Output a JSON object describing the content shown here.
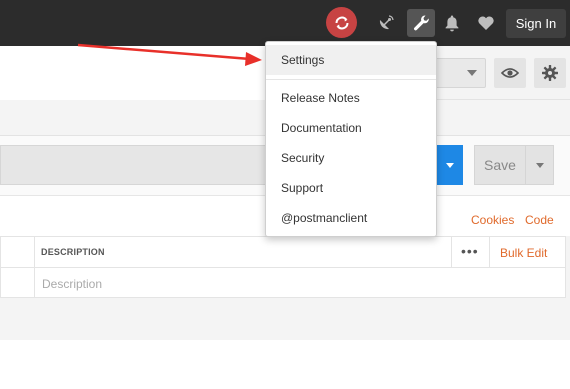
{
  "header": {
    "signin_label": "Sign In"
  },
  "icons": {
    "sync": "sync-icon",
    "satellite": "satellite-icon",
    "wrench": "wrench-icon",
    "bell": "bell-icon",
    "heart": "heart-icon",
    "eye": "eye-icon",
    "gear": "gear-icon"
  },
  "request": {
    "save_label": "Save",
    "send_color": "#1e88e5"
  },
  "links": {
    "cookies": "Cookies",
    "code": "Code"
  },
  "table": {
    "header_description": "DESCRIPTION",
    "more": "•••",
    "bulk_edit": "Bulk Edit",
    "description_placeholder": "Description"
  },
  "menu": {
    "items": [
      "Settings",
      "Release Notes",
      "Documentation",
      "Security",
      "Support",
      "@postmanclient"
    ]
  },
  "colors": {
    "accent": "#e06a2c",
    "sync_red": "#c74343",
    "annotation_arrow": "#e8302a"
  }
}
